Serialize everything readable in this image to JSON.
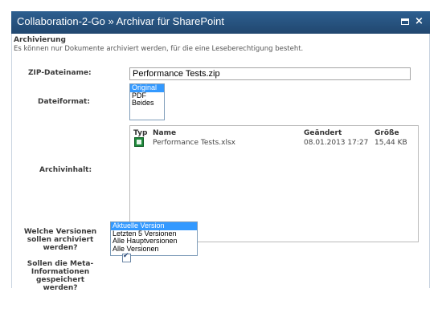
{
  "dialog": {
    "title": "Collaboration-2-Go » Archivar für SharePoint"
  },
  "section": {
    "title": "Archivierung",
    "description": "Es können nur Dokumente archiviert werden, für die eine Leseberechtigung besteht."
  },
  "zip": {
    "label": "ZIP-Dateiname:",
    "value": "Performance Tests.zip"
  },
  "format": {
    "label": "Dateiformat:",
    "options": [
      "Original",
      "PDF",
      "Beides"
    ],
    "selected": "Original"
  },
  "archive": {
    "label": "Archivinhalt:",
    "columns": [
      "Typ",
      "Name",
      "Geändert",
      "Größe"
    ],
    "rows": [
      {
        "type": "excel-icon",
        "name": "Performance Tests.xlsx",
        "modified": "08.01.2013 17:27",
        "size": "15,44 KB"
      }
    ]
  },
  "versions": {
    "label_line1": "Welche Versionen",
    "label_line2": "sollen archiviert",
    "label_line3": "werden?",
    "options": [
      "Aktuelle Version",
      "Letzten 5 Versionen",
      "Alle Hauptversionen",
      "Alle Versionen"
    ],
    "selected": "Aktuelle Version"
  },
  "metadata": {
    "label_line1": "Sollen die Meta-",
    "label_line2": "Informationen",
    "label_line3": "gespeichert",
    "label_line4": "werden?",
    "checked": true
  },
  "colors": {
    "titlebar": "#2d5f90",
    "selection": "#3399ff"
  }
}
